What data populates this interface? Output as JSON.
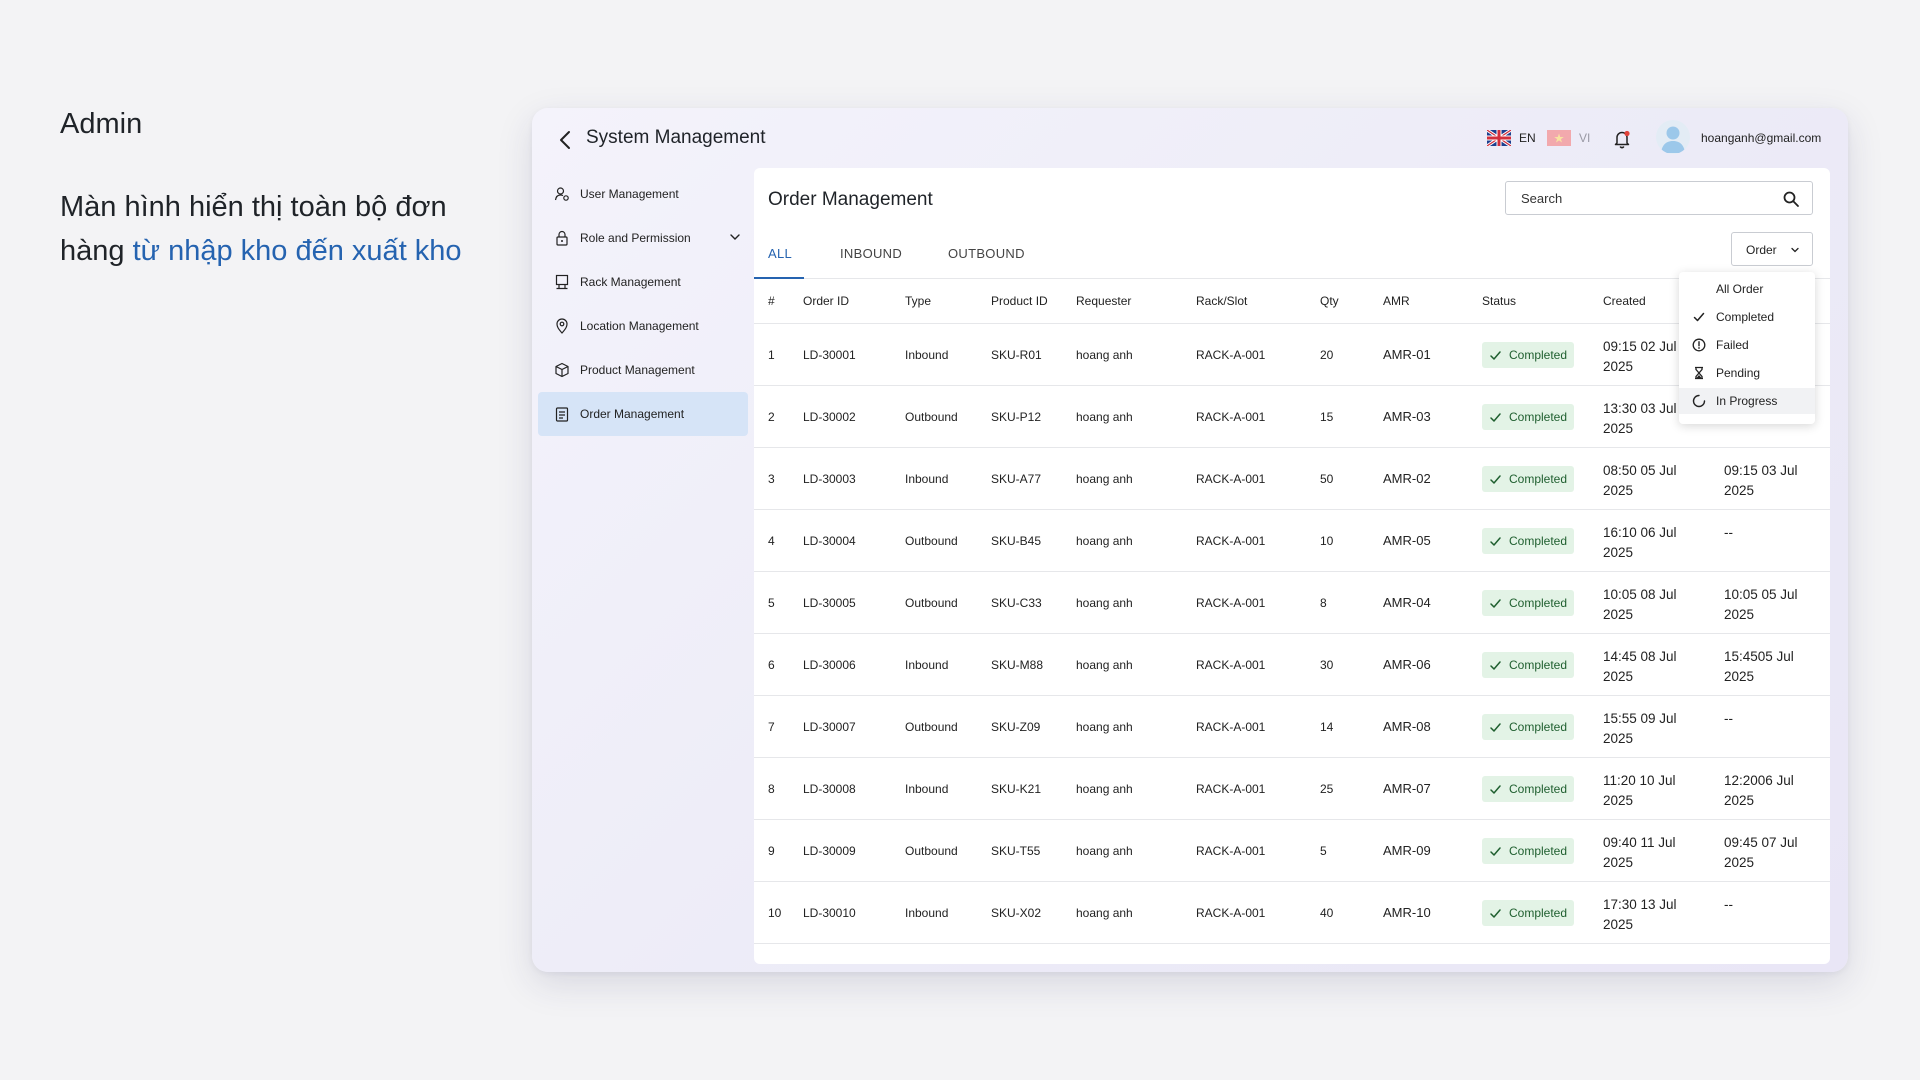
{
  "intro": {
    "title": "Admin",
    "desc_prefix": "Màn hình hiển thị toàn bộ đơn hàng ",
    "desc_highlight": "từ nhập kho đến xuất kho"
  },
  "header": {
    "title": "System Management",
    "lang_en": "EN",
    "lang_vi": "VI",
    "user_email": "hoanganh@gmail.com"
  },
  "sidebar": {
    "items": [
      {
        "label": "User Management",
        "icon": "user-gear-icon"
      },
      {
        "label": "Role and Permission",
        "icon": "lock-icon"
      },
      {
        "label": "Rack Management",
        "icon": "rack-icon"
      },
      {
        "label": "Location Management",
        "icon": "location-pin-icon"
      },
      {
        "label": "Product Management",
        "icon": "box-icon"
      },
      {
        "label": "Order Management",
        "icon": "clipboard-icon",
        "active": true
      }
    ]
  },
  "main": {
    "title": "Order Management",
    "search_placeholder": "Search",
    "tabs": [
      "ALL",
      "INBOUND",
      "OUTBOUND"
    ],
    "active_tab": "ALL",
    "order_filter_label": "Order"
  },
  "table": {
    "columns": [
      "#",
      "Order ID",
      "Type",
      "Product ID",
      "Requester",
      "Rack/Slot",
      "Qty",
      "AMR",
      "Status",
      "Created"
    ],
    "rows": [
      {
        "no": "1",
        "order_id": "LD-30001",
        "type": "Inbound",
        "product_id": "SKU-R01",
        "requester": "hoang anh",
        "rack": "RACK-A-001",
        "qty": "20",
        "amr": "AMR-01",
        "status": "Completed",
        "created_a": "09:15 02 Jul",
        "created_b": "2025",
        "done_a": "",
        "done_b": ""
      },
      {
        "no": "2",
        "order_id": "LD-30002",
        "type": "Outbound",
        "product_id": "SKU-P12",
        "requester": "hoang anh",
        "rack": "RACK-A-001",
        "qty": "15",
        "amr": "AMR-03",
        "status": "Completed",
        "created_a": "13:30 03 Jul",
        "created_b": "2025",
        "done_a": "",
        "done_b": ""
      },
      {
        "no": "3",
        "order_id": "LD-30003",
        "type": "Inbound",
        "product_id": "SKU-A77",
        "requester": "hoang anh",
        "rack": "RACK-A-001",
        "qty": "50",
        "amr": "AMR-02",
        "status": "Completed",
        "created_a": "08:50 05 Jul",
        "created_b": "2025",
        "done_a": "09:15 03 Jul",
        "done_b": "2025"
      },
      {
        "no": "4",
        "order_id": "LD-30004",
        "type": "Outbound",
        "product_id": "SKU-B45",
        "requester": "hoang anh",
        "rack": "RACK-A-001",
        "qty": "10",
        "amr": "AMR-05",
        "status": "Completed",
        "created_a": "16:10  06 Jul",
        "created_b": "2025",
        "done_a": "--",
        "done_b": ""
      },
      {
        "no": "5",
        "order_id": "LD-30005",
        "type": "Outbound",
        "product_id": "SKU-C33",
        "requester": "hoang anh",
        "rack": "RACK-A-001",
        "qty": "8",
        "amr": "AMR-04",
        "status": "Completed",
        "created_a": "10:05 08 Jul",
        "created_b": "2025",
        "done_a": "10:05 05 Jul",
        "done_b": "2025"
      },
      {
        "no": "6",
        "order_id": "LD-30006",
        "type": "Inbound",
        "product_id": "SKU-M88",
        "requester": "hoang anh",
        "rack": "RACK-A-001",
        "qty": "30",
        "amr": "AMR-06",
        "status": "Completed",
        "created_a": "14:45 08 Jul",
        "created_b": "2025",
        "done_a": "15:4505 Jul",
        "done_b": "2025"
      },
      {
        "no": "7",
        "order_id": "LD-30007",
        "type": "Outbound",
        "product_id": "SKU-Z09",
        "requester": "hoang anh",
        "rack": "RACK-A-001",
        "qty": "14",
        "amr": "AMR-08",
        "status": "Completed",
        "created_a": "15:55 09 Jul",
        "created_b": "2025",
        "done_a": "--",
        "done_b": ""
      },
      {
        "no": "8",
        "order_id": "LD-30008",
        "type": "Inbound",
        "product_id": "SKU-K21",
        "requester": "hoang anh",
        "rack": "RACK-A-001",
        "qty": "25",
        "amr": "AMR-07",
        "status": "Completed",
        "created_a": "11:20 10 Jul",
        "created_b": "2025",
        "done_a": "12:2006 Jul",
        "done_b": "2025"
      },
      {
        "no": "9",
        "order_id": "LD-30009",
        "type": "Outbound",
        "product_id": "SKU-T55",
        "requester": "hoang anh",
        "rack": "RACK-A-001",
        "qty": "5",
        "amr": "AMR-09",
        "status": "Completed",
        "created_a": "09:40 11 Jul",
        "created_b": "2025",
        "done_a": "09:45 07 Jul",
        "done_b": "2025"
      },
      {
        "no": "10",
        "order_id": "LD-30010",
        "type": "Inbound",
        "product_id": "SKU-X02",
        "requester": "hoang anh",
        "rack": "RACK-A-001",
        "qty": "40",
        "amr": "AMR-10",
        "status": "Completed",
        "created_a": "17:30 13 Jul",
        "created_b": "2025",
        "done_a": "--",
        "done_b": ""
      }
    ]
  },
  "order_dropdown": {
    "items": [
      {
        "label": "All Order",
        "icon": ""
      },
      {
        "label": "Completed",
        "icon": "check-icon"
      },
      {
        "label": "Failed",
        "icon": "alert-circle-icon"
      },
      {
        "label": "Pending",
        "icon": "hourglass-icon"
      },
      {
        "label": "In Progress",
        "icon": "spinner-icon"
      }
    ]
  },
  "colors": {
    "accent": "#2563b0",
    "active_sidebar": "#d6e4f7",
    "badge_bg": "#e3f3e6",
    "badge_text": "#1f5f2f"
  }
}
